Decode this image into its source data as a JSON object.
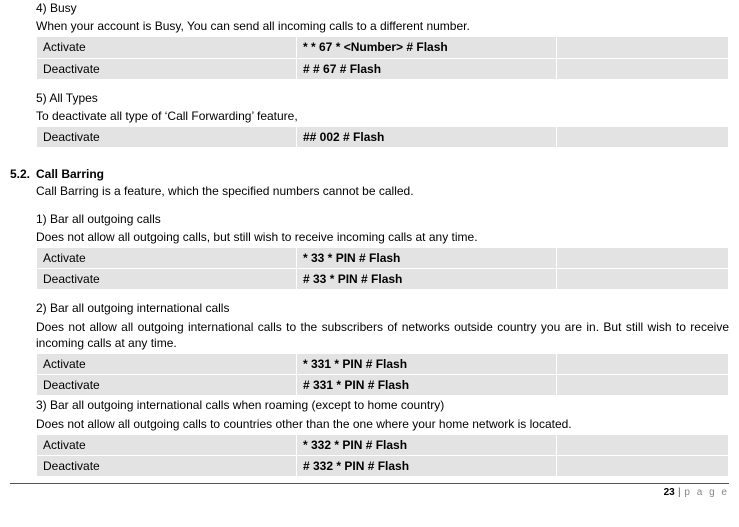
{
  "busy": {
    "title": "4) Busy",
    "desc": "When your account is Busy, You can send all incoming calls to a different number.",
    "rows": [
      {
        "label": "Activate",
        "code": "* * 67 * <Number> # Flash"
      },
      {
        "label": "Deactivate",
        "code": "# # 67 # Flash"
      }
    ]
  },
  "alltypes": {
    "title": "5) All Types",
    "desc": "To deactivate all type of ‘Call Forwarding’ feature,",
    "rows": [
      {
        "label": "Deactivate",
        "code": "## 002 # Flash"
      }
    ]
  },
  "section52": {
    "num": "5.2.",
    "title": "Call Barring",
    "desc": "Call Barring is a feature, which the specified numbers cannot be called."
  },
  "bar1": {
    "title": "1) Bar all outgoing calls",
    "desc": "Does not allow all outgoing calls, but still wish to receive incoming calls at any time.",
    "rows": [
      {
        "label": "Activate",
        "code": "* 33 * PIN # Flash"
      },
      {
        "label": "Deactivate",
        "code": "# 33 * PIN # Flash"
      }
    ]
  },
  "bar2": {
    "title": "2) Bar all outgoing international calls",
    "desc": "Does not allow all outgoing international calls to the subscribers of networks outside country you are in. But still wish to receive incoming calls at any time.",
    "rows": [
      {
        "label": "Activate",
        "code": "* 331 * PIN # Flash"
      },
      {
        "label": "Deactivate",
        "code": "# 331 * PIN # Flash"
      }
    ]
  },
  "bar3": {
    "title": "3) Bar all outgoing international calls when roaming (except to home country)",
    "desc": "Does not allow all outgoing calls to countries other than the one where your home network is located.",
    "rows": [
      {
        "label": "Activate",
        "code": "* 332 * PIN # Flash"
      },
      {
        "label": "Deactivate",
        "code": "# 332 * PIN # Flash"
      }
    ]
  },
  "footer": {
    "pagenum": "23",
    "sep": " | ",
    "word": "p a g e"
  }
}
